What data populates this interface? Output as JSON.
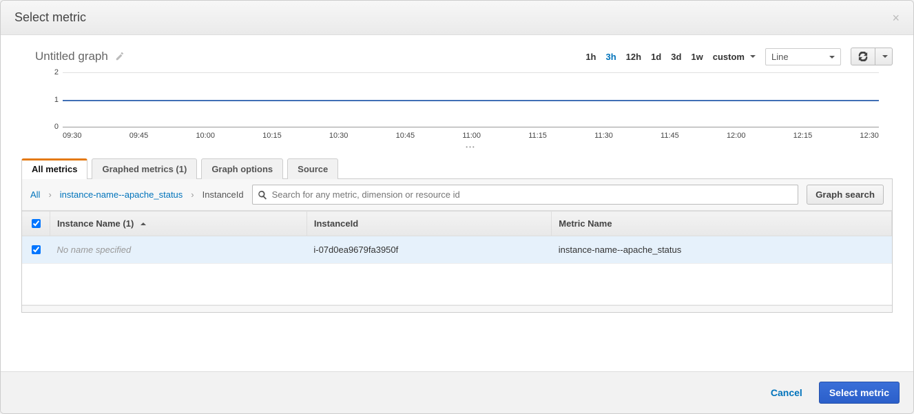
{
  "modal": {
    "title": "Select metric",
    "close_glyph": "×"
  },
  "graph": {
    "title": "Untitled graph",
    "ranges": [
      "1h",
      "3h",
      "12h",
      "1d",
      "3d",
      "1w"
    ],
    "active_range_index": 1,
    "custom_label": "custom",
    "chart_type_label": "Line"
  },
  "chart_data": {
    "type": "line",
    "title": "",
    "xlabel": "",
    "ylabel": "",
    "ylim": [
      0,
      2
    ],
    "yticks": [
      0,
      1,
      2
    ],
    "x": [
      "09:30",
      "09:45",
      "10:00",
      "10:15",
      "10:30",
      "10:45",
      "11:00",
      "11:15",
      "11:30",
      "11:45",
      "12:00",
      "12:15",
      "12:30"
    ],
    "series": [
      {
        "name": "instance-name--apache_status",
        "values": [
          1,
          1,
          1,
          1,
          1,
          1,
          1,
          1,
          1,
          1,
          1,
          1,
          1
        ],
        "color": "#3f6fb5"
      }
    ]
  },
  "tabs": {
    "items": [
      {
        "label": "All metrics"
      },
      {
        "label": "Graphed metrics (1)"
      },
      {
        "label": "Graph options"
      },
      {
        "label": "Source"
      }
    ],
    "active_index": 0
  },
  "breadcrumb": {
    "all_label": "All",
    "namespace": "instance-name--apache_status",
    "dimension": "InstanceId"
  },
  "search": {
    "placeholder": "Search for any metric, dimension or resource id",
    "graph_search_label": "Graph search"
  },
  "table": {
    "columns": {
      "instance_name": "Instance Name",
      "instance_name_count": "(1)",
      "instance_id": "InstanceId",
      "metric_name": "Metric Name"
    },
    "rows": [
      {
        "checked": true,
        "instance_name": "No name specified",
        "instance_name_missing": true,
        "instance_id": "i-07d0ea9679fa3950f",
        "metric_name": "instance-name--apache_status"
      }
    ]
  },
  "footer": {
    "cancel_label": "Cancel",
    "select_label": "Select metric"
  }
}
